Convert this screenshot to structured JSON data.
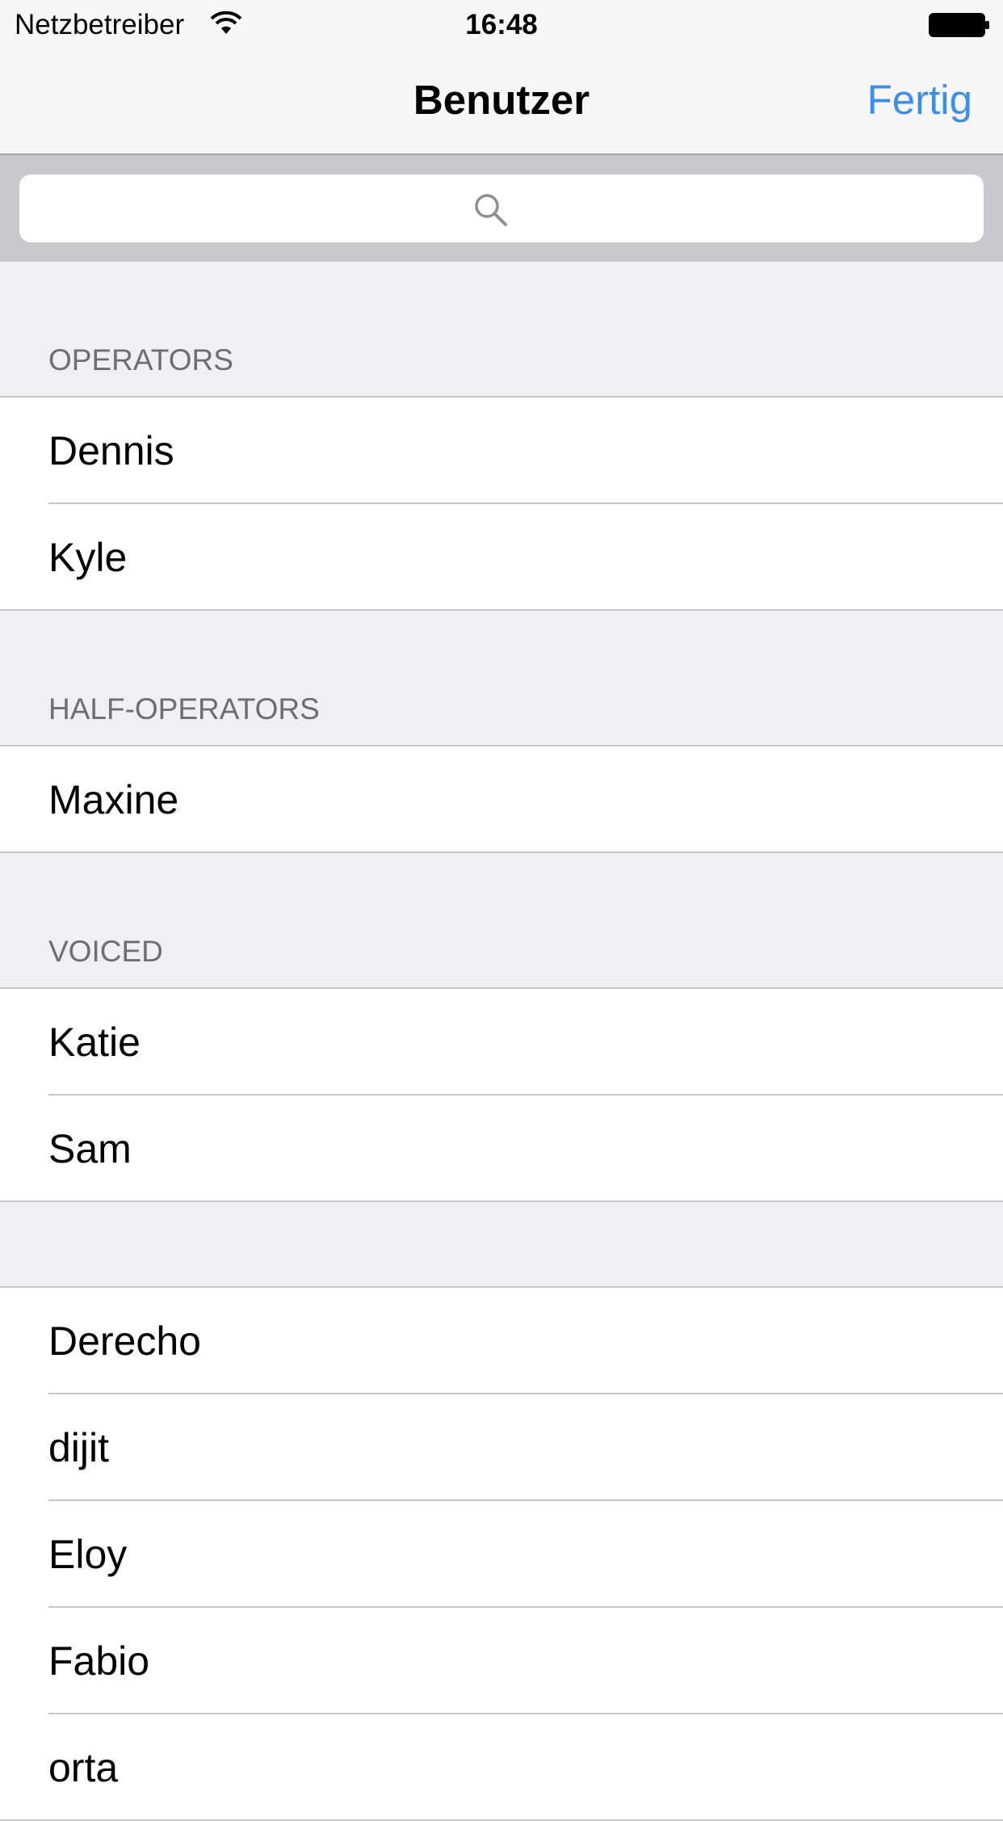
{
  "status_bar": {
    "carrier": "Netzbetreiber",
    "time": "16:48",
    "wifi_icon": "wifi-icon",
    "battery_icon": "battery-icon"
  },
  "nav_bar": {
    "title": "Benutzer",
    "done_label": "Fertig",
    "accent_color": "#3b8fe8"
  },
  "search": {
    "placeholder": "",
    "icon": "search-icon"
  },
  "sections": [
    {
      "header": "OPERATORS",
      "rows": [
        "Dennis",
        "Kyle"
      ]
    },
    {
      "header": "HALF-OPERATORS",
      "rows": [
        "Maxine"
      ]
    },
    {
      "header": "VOICED",
      "rows": [
        "Katie",
        "Sam"
      ]
    },
    {
      "header": "",
      "rows": [
        "Derecho",
        "dijit",
        "Eloy",
        "Fabio",
        "orta"
      ]
    }
  ]
}
